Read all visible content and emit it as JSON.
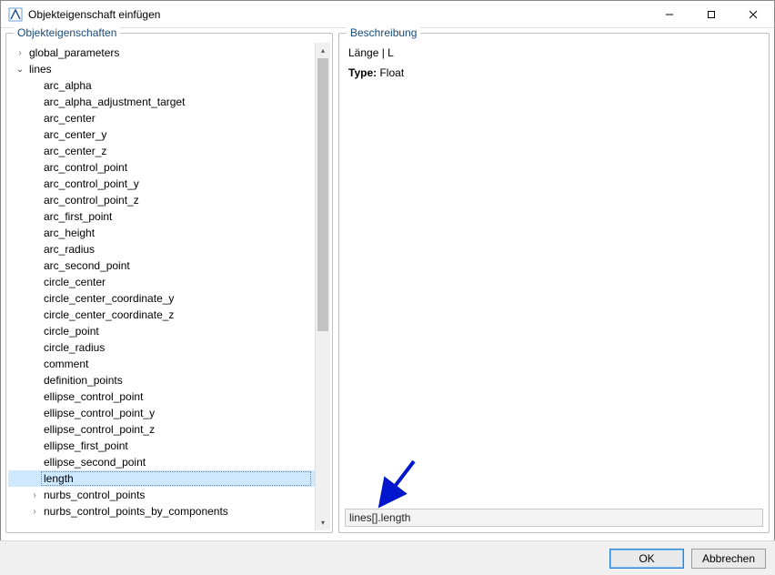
{
  "window": {
    "title": "Objekteigenschaft einfügen"
  },
  "panels": {
    "left_title": "Objekteigenschaften",
    "right_title": "Beschreibung"
  },
  "tree": {
    "top_nodes": [
      {
        "label": "global_parameters",
        "expandable": true,
        "expanded": false
      },
      {
        "label": "lines",
        "expandable": true,
        "expanded": true
      }
    ],
    "lines_children": [
      "arc_alpha",
      "arc_alpha_adjustment_target",
      "arc_center",
      "arc_center_y",
      "arc_center_z",
      "arc_control_point",
      "arc_control_point_y",
      "arc_control_point_z",
      "arc_first_point",
      "arc_height",
      "arc_radius",
      "arc_second_point",
      "circle_center",
      "circle_center_coordinate_y",
      "circle_center_coordinate_z",
      "circle_point",
      "circle_radius",
      "comment",
      "definition_points",
      "ellipse_control_point",
      "ellipse_control_point_y",
      "ellipse_control_point_z",
      "ellipse_first_point",
      "ellipse_second_point"
    ],
    "lines_selected": "length",
    "lines_tail": [
      {
        "label": "nurbs_control_points",
        "expandable": true
      },
      {
        "label": "nurbs_control_points_by_components",
        "expandable": true
      }
    ]
  },
  "description": {
    "line1": "Länge | L",
    "type_label": "Type:",
    "type_value": "Float"
  },
  "path_field": {
    "value": "lines[].length"
  },
  "footer": {
    "ok": "OK",
    "cancel": "Abbrechen"
  }
}
